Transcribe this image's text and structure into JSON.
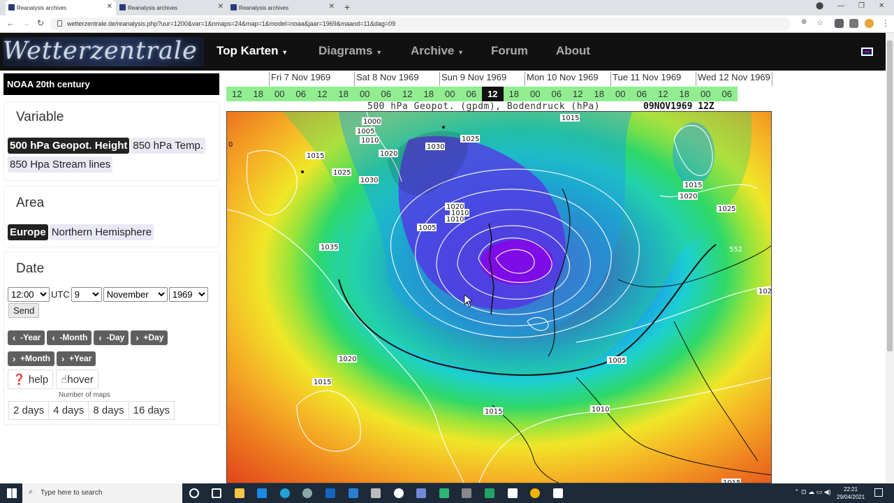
{
  "browser": {
    "tabs": [
      {
        "title": "Reanalysis archives",
        "active": true
      },
      {
        "title": "Reanalysis archives",
        "active": false
      },
      {
        "title": "Reanalysis archives",
        "active": false
      }
    ],
    "new_tab": "+",
    "url": "wetterzentrale.de/reanalysis.php?uur=1200&var=1&nmaps=24&map=1&model=noaa&jaar=1969&maand=11&dag=09"
  },
  "site": {
    "logo": "Wetterzentrale",
    "nav": [
      "Top Karten",
      "Diagrams",
      "Archive",
      "Forum",
      "About"
    ],
    "nav_active": "Top Karten"
  },
  "sidebar": {
    "model_title": "NOAA 20th century",
    "variable": {
      "title": "Variable",
      "options": [
        {
          "label": "500 hPa Geopot. Height",
          "selected": true
        },
        {
          "label": "850 hPa Temp.",
          "selected": false
        },
        {
          "label": "850 Hpa Stream lines",
          "selected": false
        }
      ]
    },
    "area": {
      "title": "Area",
      "options": [
        {
          "label": "Europe",
          "selected": true
        },
        {
          "label": "Northern Hemisphere",
          "selected": false
        }
      ]
    },
    "date": {
      "title": "Date",
      "hour": "12:00",
      "utc": "UTC",
      "day": "9",
      "month": "November",
      "year": "1969",
      "send": "Send",
      "steps": [
        "-Year",
        "-Month",
        "-Day",
        "+Day",
        "+Month",
        "+Year"
      ],
      "help": "help",
      "hover": "hover",
      "nmaps_label": "Number of maps",
      "nmaps": [
        "2 days",
        "4 days",
        "8 days",
        "16 days"
      ]
    }
  },
  "timeline": {
    "days": [
      "Fri 7 Nov 1969",
      "Sat 8 Nov 1969",
      "Sun 9 Nov 1969",
      "Mon 10 Nov 1969",
      "Tue 11 Nov 1969",
      "Wed 12 Nov 1969"
    ],
    "hours": [
      "12",
      "18",
      "00",
      "06",
      "12",
      "18",
      "00",
      "06",
      "12",
      "18",
      "00",
      "06",
      "12",
      "18",
      "00",
      "06",
      "12",
      "18",
      "00",
      "06",
      "12",
      "18",
      "00",
      "06"
    ],
    "current": "12",
    "current_index": 12
  },
  "map": {
    "title": "500 hPa Geopot. (gpdm), Bodendruck (hPa)",
    "date": "09NOV1969 12Z",
    "pressure_labels": [
      "1000",
      "1005",
      "1010",
      "1015",
      "1020",
      "1025",
      "1030",
      "1035",
      "1010",
      "1005",
      "1020",
      "1025",
      "1030",
      "1015",
      "1020",
      "1025",
      "1015",
      "1020",
      "1005",
      "1010",
      "1015",
      "1015",
      "1015",
      "1010",
      "552",
      "102",
      "0"
    ]
  },
  "taskbar": {
    "search_placeholder": "Type here to search",
    "time": "22:21",
    "date": "29/04/2021"
  }
}
